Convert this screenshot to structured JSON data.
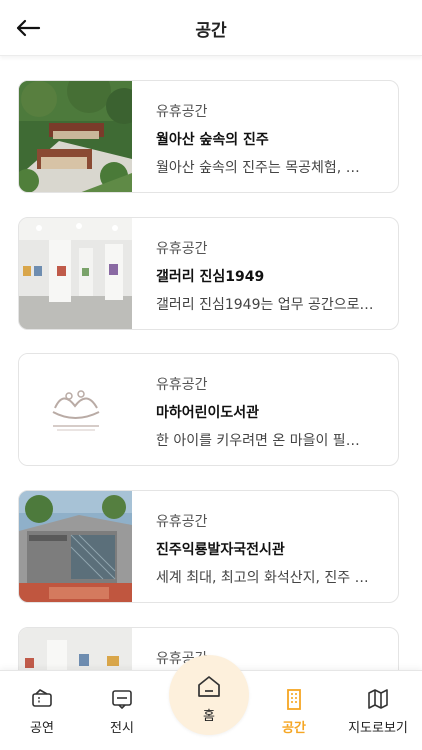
{
  "header": {
    "title": "공간",
    "back_icon": "arrow-left-icon"
  },
  "cards": [
    {
      "category": "유휴공간",
      "title": "월아산 숲속의 진주",
      "description": "월아산 숲속의 진주는 목공체험, …",
      "thumb": "forest-lodge-photo"
    },
    {
      "category": "유휴공간",
      "title": "갤러리 진심1949",
      "description": "갤러리 진심1949는 업무 공간으로…",
      "thumb": "gallery-interior-photo"
    },
    {
      "category": "유휴공간",
      "title": "마하어린이도서관",
      "description": "한 아이를 키우려면 온 마을이 필…",
      "thumb": "library-logo"
    },
    {
      "category": "유휴공간",
      "title": "진주익룡발자국전시관",
      "description": "세계 최대, 최고의 화석산지, 진주 …",
      "thumb": "museum-building-photo"
    },
    {
      "category": "유휴공간",
      "title": "",
      "description": "",
      "thumb": "gallery-interior-photo"
    }
  ],
  "tabbar": {
    "tabs": [
      {
        "label": "공연",
        "icon": "ticket-icon",
        "active": false
      },
      {
        "label": "전시",
        "icon": "frame-icon",
        "active": false
      },
      {
        "label": "홈",
        "icon": "home-icon",
        "active": false
      },
      {
        "label": "공간",
        "icon": "building-icon",
        "active": true
      },
      {
        "label": "지도로보기",
        "icon": "map-icon",
        "active": false
      }
    ]
  },
  "colors": {
    "accent": "#f5a623",
    "home_bg": "#fdf0dc",
    "card_border": "#e4e4e4"
  }
}
